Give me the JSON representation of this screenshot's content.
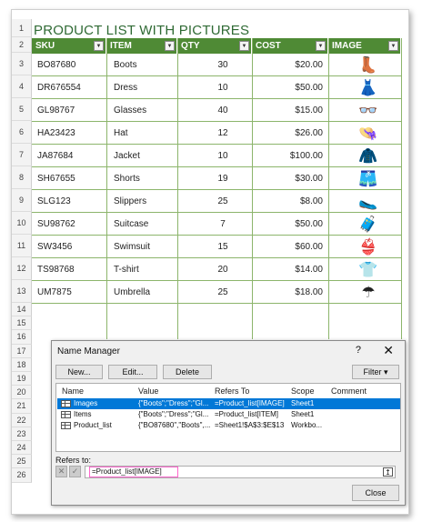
{
  "title": "PRODUCT LIST WITH PICTURES",
  "row_numbers": [
    "1",
    "2",
    "3",
    "4",
    "5",
    "6",
    "7",
    "8",
    "9",
    "10",
    "11",
    "12",
    "13",
    "14",
    "15",
    "16",
    "17",
    "18",
    "19",
    "20",
    "21",
    "22",
    "23",
    "24",
    "25",
    "26"
  ],
  "headers": [
    "SKU",
    "ITEM",
    "QTY",
    "COST",
    "IMAGE"
  ],
  "rows": [
    {
      "sku": "BO87680",
      "item": "Boots",
      "qty": "30",
      "cost": "$20.00",
      "icon": "boots-icon",
      "glyph": "👢"
    },
    {
      "sku": "DR676554",
      "item": "Dress",
      "qty": "10",
      "cost": "$50.00",
      "icon": "dress-icon",
      "glyph": "👗"
    },
    {
      "sku": "GL98767",
      "item": "Glasses",
      "qty": "40",
      "cost": "$15.00",
      "icon": "glasses-icon",
      "glyph": "👓"
    },
    {
      "sku": "HA23423",
      "item": "Hat",
      "qty": "12",
      "cost": "$26.00",
      "icon": "hat-icon",
      "glyph": "👒"
    },
    {
      "sku": "JA87684",
      "item": "Jacket",
      "qty": "10",
      "cost": "$100.00",
      "icon": "jacket-icon",
      "glyph": "🧥"
    },
    {
      "sku": "SH67655",
      "item": "Shorts",
      "qty": "19",
      "cost": "$30.00",
      "icon": "shorts-icon",
      "glyph": "🩳"
    },
    {
      "sku": "SLG123",
      "item": "Slippers",
      "qty": "25",
      "cost": "$8.00",
      "icon": "slippers-icon",
      "glyph": "🥿"
    },
    {
      "sku": "SU98762",
      "item": "Suitcase",
      "qty": "7",
      "cost": "$50.00",
      "icon": "suitcase-icon",
      "glyph": "🧳"
    },
    {
      "sku": "SW3456",
      "item": "Swimsuit",
      "qty": "15",
      "cost": "$60.00",
      "icon": "swimsuit-icon",
      "glyph": "👙"
    },
    {
      "sku": "TS98768",
      "item": "T-shirt",
      "qty": "20",
      "cost": "$14.00",
      "icon": "tshirt-icon",
      "glyph": "👕"
    },
    {
      "sku": "UM7875",
      "item": "Umbrella",
      "qty": "25",
      "cost": "$18.00",
      "icon": "umbrella-icon",
      "glyph": "☂"
    }
  ],
  "dialog": {
    "title": "Name Manager",
    "help": "?",
    "close_glyph": "✕",
    "buttons": {
      "new": "New...",
      "edit": "Edit...",
      "delete": "Delete",
      "filter": "Filter ▾"
    },
    "columns": [
      "Name",
      "Value",
      "Refers To",
      "Scope",
      "Comment"
    ],
    "names": [
      {
        "name": "Images",
        "value": "{\"Boots\";\"Dress\";\"Gl...",
        "refers": "=Product_list[IMAGE]",
        "scope": "Sheet1",
        "comment": "",
        "selected": true
      },
      {
        "name": "Items",
        "value": "{\"Boots\";\"Dress\";\"Gl...",
        "refers": "=Product_list[ITEM]",
        "scope": "Sheet1",
        "comment": "",
        "selected": false
      },
      {
        "name": "Product_list",
        "value": "{\"BO87680\",\"Boots\",...",
        "refers": "=Sheet1!$A$3:$E$13",
        "scope": "Workbo...",
        "comment": "",
        "selected": false
      }
    ],
    "refers_to_label": "Refers to:",
    "refers_to_value": "=Product_list[IMAGE]",
    "close_button": "Close"
  },
  "colors": {
    "header_green": "#4f8a35",
    "title_green": "#2f6a34",
    "selection_blue": "#0078d7",
    "ref_highlight": "#ff66cc"
  }
}
